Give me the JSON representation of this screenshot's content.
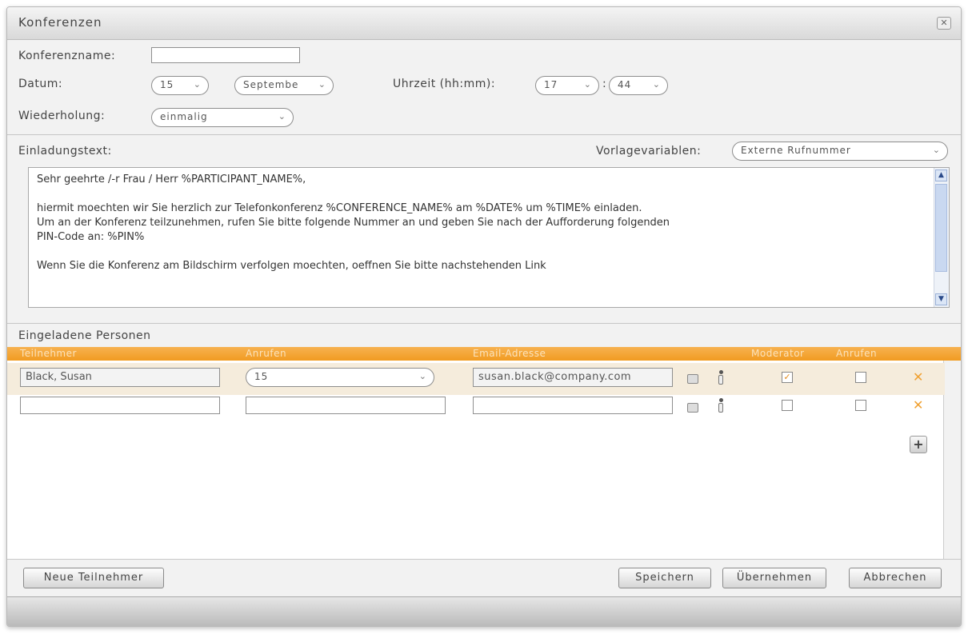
{
  "dialog": {
    "title": "Konferenzen",
    "close_label": "✕"
  },
  "form": {
    "name_label": "Konferenzname:",
    "name_value": "",
    "date_label": "Datum:",
    "day_value": "15",
    "month_value": "Septembe",
    "time_label": "Uhrzeit (hh:mm):",
    "hour_value": "17",
    "time_colon": ":",
    "minute_value": "44",
    "repeat_label": "Wiederholung:",
    "repeat_value": "einmalig"
  },
  "invitation": {
    "label": "Einladungstext:",
    "template_label": "Vorlagevariablen:",
    "template_value": "Externe Rufnummer",
    "lines": [
      "Sehr geehrte /-r Frau / Herr %PARTICIPANT_NAME%,",
      "hiermit moechten wir Sie herzlich zur Telefonkonferenz %CONFERENCE_NAME% am %DATE% um %TIME% einladen.",
      "Um an der Konferenz teilzunehmen, rufen Sie bitte folgende Nummer an  und geben Sie nach der Aufforderung folgenden",
      "PIN-Code an: %PIN%",
      "Wenn Sie die Konferenz am Bildschirm verfolgen moechten, oeffnen Sie bitte nachstehenden Link"
    ]
  },
  "participants": {
    "section_label": "Eingeladene Personen",
    "columns": [
      "Teilnehmer",
      "Anrufen",
      "Email-Adresse",
      "Moderator",
      "Anrufen"
    ],
    "rows": [
      {
        "name": "Black, Susan",
        "call": "15",
        "email": "susan.black@company.com",
        "moderator": true,
        "call_checked": false
      },
      {
        "name": "",
        "call": "",
        "email": "",
        "moderator": false,
        "call_checked": false
      }
    ],
    "add_label": "+",
    "delete_label": "✕"
  },
  "footer": {
    "new_participant": "Neue Teilnehmer",
    "save": "Speichern",
    "apply": "Übernehmen",
    "cancel": "Abbrechen"
  },
  "icons": {
    "chevron": "⌄",
    "check": "✓",
    "scroll_up": "▲",
    "scroll_down": "▼"
  },
  "colors": {
    "accent": "#f19b21",
    "delete": "#f0a030"
  }
}
